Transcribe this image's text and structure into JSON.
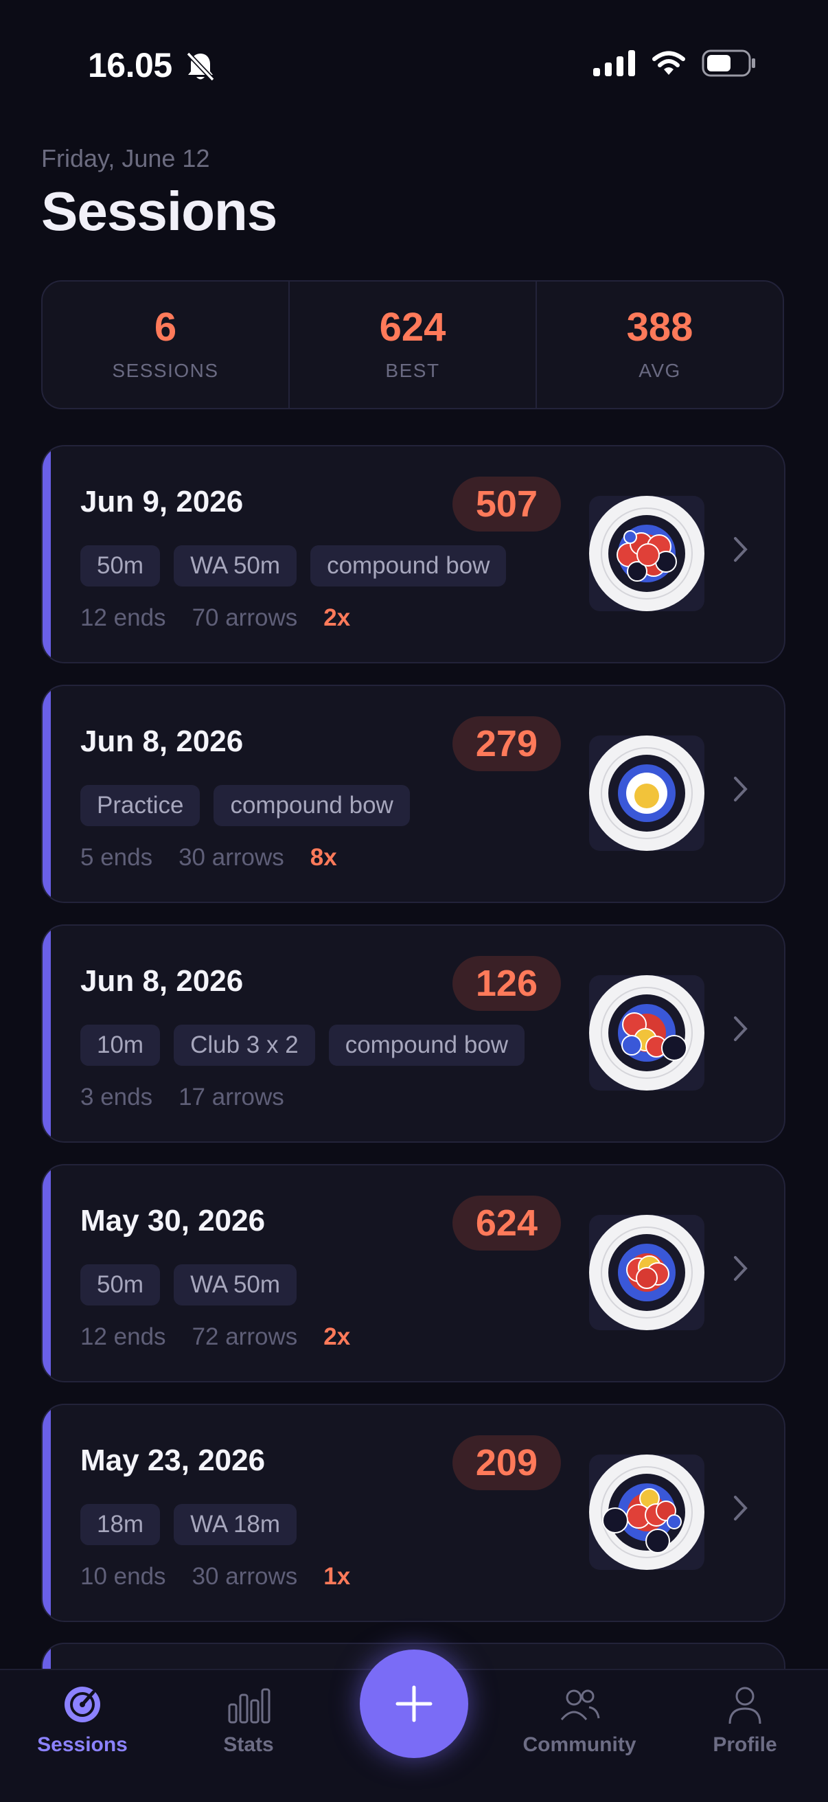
{
  "status_bar": {
    "time": "16.05",
    "icons": [
      "bell-slash-icon",
      "signal-icon",
      "wifi-icon",
      "battery-icon"
    ]
  },
  "header": {
    "date": "Friday, June 12",
    "title": "Sessions"
  },
  "summary": [
    {
      "value": "6",
      "label": "SESSIONS"
    },
    {
      "value": "624",
      "label": "BEST"
    },
    {
      "value": "388",
      "label": "AVG"
    }
  ],
  "sessions": [
    {
      "date": "Jun 9, 2026",
      "score": "507",
      "tags": [
        "50m",
        "WA 50m",
        "compound bow"
      ],
      "ends": "12 ends",
      "arrows": "70 arrows",
      "multiplier": "2x"
    },
    {
      "date": "Jun 8, 2026",
      "score": "279",
      "tags": [
        "Practice",
        "compound bow"
      ],
      "ends": "5 ends",
      "arrows": "30 arrows",
      "multiplier": "8x"
    },
    {
      "date": "Jun 8, 2026",
      "score": "126",
      "tags": [
        "10m",
        "Club 3 x 2",
        "compound bow"
      ],
      "ends": "3 ends",
      "arrows": "17 arrows",
      "multiplier": ""
    },
    {
      "date": "May 30, 2026",
      "score": "624",
      "tags": [
        "50m",
        "WA 50m"
      ],
      "ends": "12 ends",
      "arrows": "72 arrows",
      "multiplier": "2x"
    },
    {
      "date": "May 23, 2026",
      "score": "209",
      "tags": [
        "18m",
        "WA 18m"
      ],
      "ends": "10 ends",
      "arrows": "30 arrows",
      "multiplier": "1x"
    }
  ],
  "tabs": [
    {
      "label": "Sessions",
      "icon": "target-icon",
      "active": true
    },
    {
      "label": "Stats",
      "icon": "bar-chart-icon",
      "active": false
    },
    {
      "label": "Community",
      "icon": "people-icon",
      "active": false
    },
    {
      "label": "Profile",
      "icon": "person-icon",
      "active": false
    }
  ],
  "fab_icon": "plus-icon",
  "colors": {
    "accent": "#7a6cf6",
    "score": "#ff7a5a",
    "background": "#0c0c16"
  }
}
